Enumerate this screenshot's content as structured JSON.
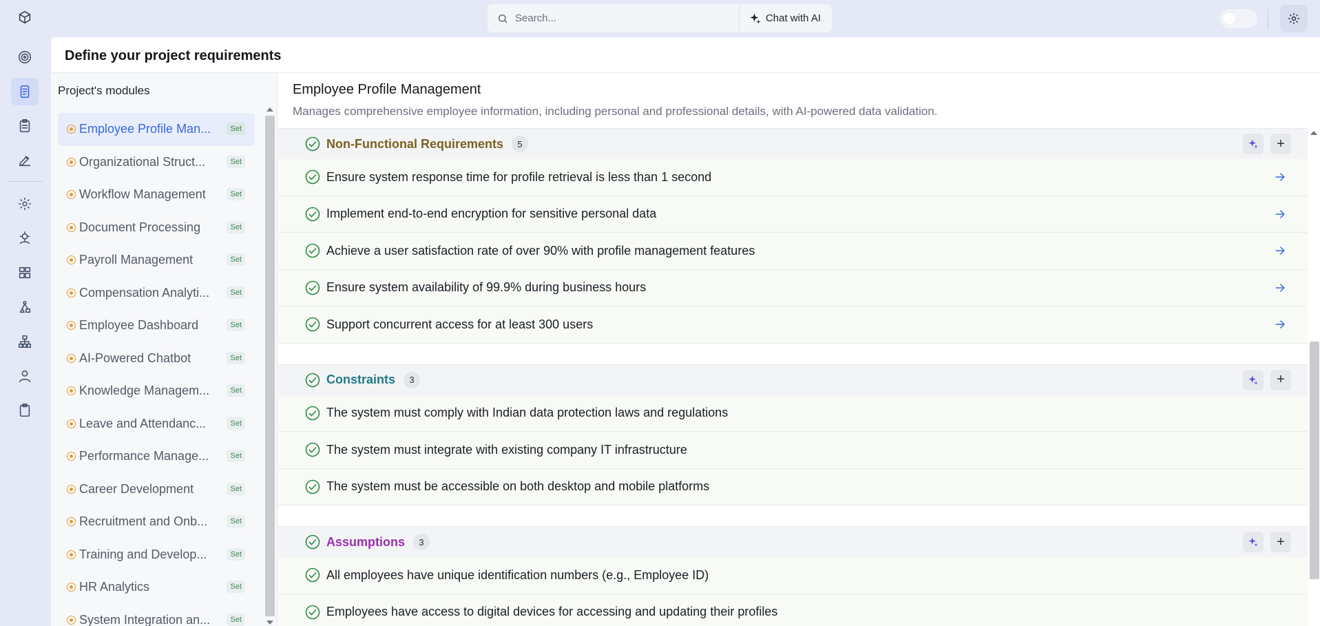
{
  "search": {
    "placeholder": "Search...",
    "chat_label": "Chat with AI"
  },
  "page": {
    "title": "Define your project requirements"
  },
  "modules": {
    "title": "Project's modules",
    "badge": "Set",
    "items": [
      {
        "label": "Employee Profile Man...",
        "active": true
      },
      {
        "label": "Organizational Struct..."
      },
      {
        "label": "Workflow Management"
      },
      {
        "label": "Document Processing"
      },
      {
        "label": "Payroll Management"
      },
      {
        "label": "Compensation Analyti..."
      },
      {
        "label": "Employee Dashboard"
      },
      {
        "label": "AI-Powered Chatbot"
      },
      {
        "label": "Knowledge Managem..."
      },
      {
        "label": "Leave and Attendanc..."
      },
      {
        "label": "Performance Manage..."
      },
      {
        "label": "Career Development"
      },
      {
        "label": "Recruitment and Onb..."
      },
      {
        "label": "Training and Develop..."
      },
      {
        "label": "HR Analytics"
      },
      {
        "label": "System Integration an..."
      }
    ]
  },
  "detail": {
    "title": "Employee Profile Management",
    "description": "Manages comprehensive employee information, including personal and professional details, with AI-powered data validation."
  },
  "sections": [
    {
      "name": "Non-Functional Requirements",
      "count": "5",
      "color": "#7a6220",
      "has_arrows": true,
      "items": [
        "Ensure system response time for profile retrieval is less than 1 second",
        "Implement end-to-end encryption for sensitive personal data",
        "Achieve a user satisfaction rate of over 90% with profile management features",
        "Ensure system availability of 99.9% during business hours",
        "Support concurrent access for at least 300 users"
      ]
    },
    {
      "name": "Constraints",
      "count": "3",
      "color": "#1f7a86",
      "has_arrows": false,
      "items": [
        "The system must comply with Indian data protection laws and regulations",
        "The system must integrate with existing company IT infrastructure",
        "The system must be accessible on both desktop and mobile platforms"
      ]
    },
    {
      "name": "Assumptions",
      "count": "3",
      "color": "#9b2fb0",
      "has_arrows": false,
      "items": [
        "All employees have unique identification numbers (e.g., Employee ID)",
        "Employees have access to digital devices for accessing and updating their profiles"
      ]
    }
  ],
  "colors": {
    "accent": "#3a68e0",
    "check": "#2a8a3e",
    "pending_dot": "#e79b2e"
  }
}
